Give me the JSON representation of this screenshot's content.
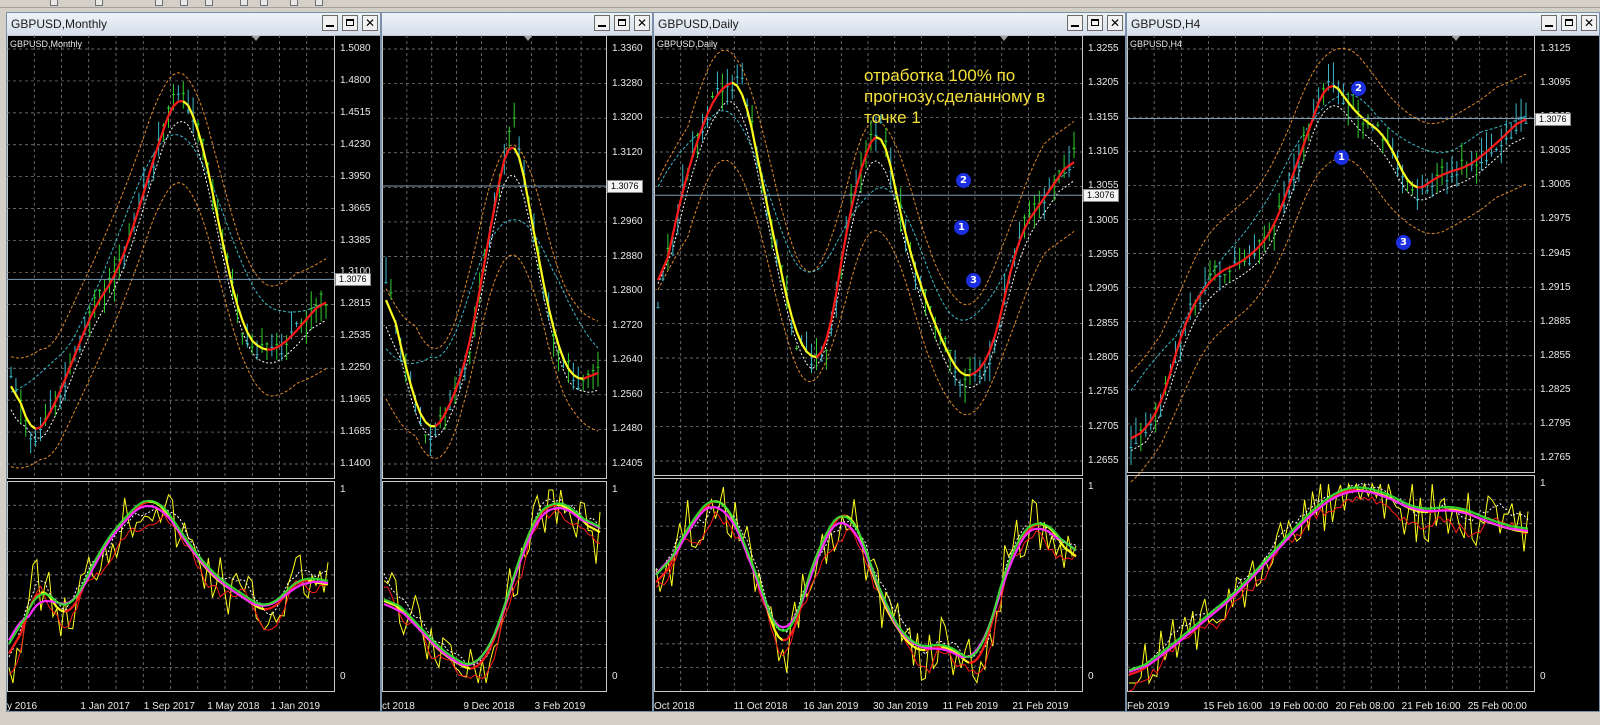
{
  "colors": {
    "background": "#000000",
    "grid": "#8c8c8c",
    "bull_candle": "#2fcf2f",
    "bear_candle": "#3ab8c8",
    "ma_up": "#ff1a1a",
    "ma_down": "#ffff1e",
    "envelope_outer": "#e08a2a",
    "envelope_inner": "#3ab8c8",
    "signal_dashed": "#ffffff",
    "osc_fast": "#ff2aff",
    "osc_green": "#32e632",
    "marker": "#1b2fe0",
    "note_text": "#f5e13b"
  },
  "windows": [
    {
      "id": "monthly",
      "title": "GBPUSD,Monthly",
      "chart_label": "GBPUSD,Monthly",
      "current_price": "1.3076",
      "y_labels": [
        "1.5080",
        "1.4800",
        "1.4515",
        "1.4230",
        "1.3950",
        "1.3665",
        "1.3385",
        "1.3100",
        "1.2815",
        "1.2535",
        "1.2250",
        "1.1965",
        "1.1685",
        "1.1400"
      ],
      "x_labels": [
        "y 2016",
        "1 Jan 2017",
        "1 Sep 2017",
        "1 May 2018",
        "1 Jan 2019"
      ],
      "osc_labels": [
        "1",
        "0"
      ],
      "note": "",
      "markers": []
    },
    {
      "id": "weekly",
      "title": "",
      "chart_label": "",
      "current_price": "1.3076",
      "y_labels": [
        "1.3360",
        "1.3280",
        "1.3200",
        "1.3120",
        "1.3040",
        "1.2960",
        "1.2880",
        "1.2800",
        "1.2720",
        "1.2640",
        "1.2560",
        "1.2480",
        "1.2405"
      ],
      "x_labels": [
        "ct 2018",
        "9 Dec 2018",
        "3 Feb 2019"
      ],
      "osc_labels": [
        "1",
        "0"
      ],
      "note": "",
      "markers": []
    },
    {
      "id": "daily",
      "title": "GBPUSD,Daily",
      "chart_label": "GBPUSD,Daily",
      "current_price": "1.3076",
      "y_labels": [
        "1.3255",
        "1.3205",
        "1.3155",
        "1.3105",
        "1.3055",
        "1.3005",
        "1.2955",
        "1.2905",
        "1.2855",
        "1.2805",
        "1.2755",
        "1.2705",
        "1.2655"
      ],
      "x_labels": [
        "Oct 2018",
        "11 Oct 2018",
        "16 Jan 2019",
        "30 Jan 2019",
        "11 Feb 2019",
        "21 Feb 2019"
      ],
      "osc_labels": [
        "1",
        "0"
      ],
      "note": "отработка 100% по\nпрогнозу,сделанному в\nточке 1",
      "markers": [
        "2",
        "1",
        "3"
      ]
    },
    {
      "id": "h4",
      "title": "GBPUSD,H4",
      "chart_label": "GBPUSD,H4",
      "current_price": "1.3076",
      "y_labels": [
        "1.3125",
        "1.3095",
        "1.3065",
        "1.3035",
        "1.3005",
        "1.2975",
        "1.2945",
        "1.2915",
        "1.2885",
        "1.2855",
        "1.2825",
        "1.2795",
        "1.2765"
      ],
      "x_labels": [
        "Feb 2019",
        "15 Feb 16:00",
        "19 Feb 00:00",
        "20 Feb 08:00",
        "21 Feb 16:00",
        "25 Feb 00:00"
      ],
      "osc_labels": [
        "1",
        "0"
      ],
      "note": "",
      "markers": [
        "2",
        "1",
        "3"
      ]
    }
  ]
}
